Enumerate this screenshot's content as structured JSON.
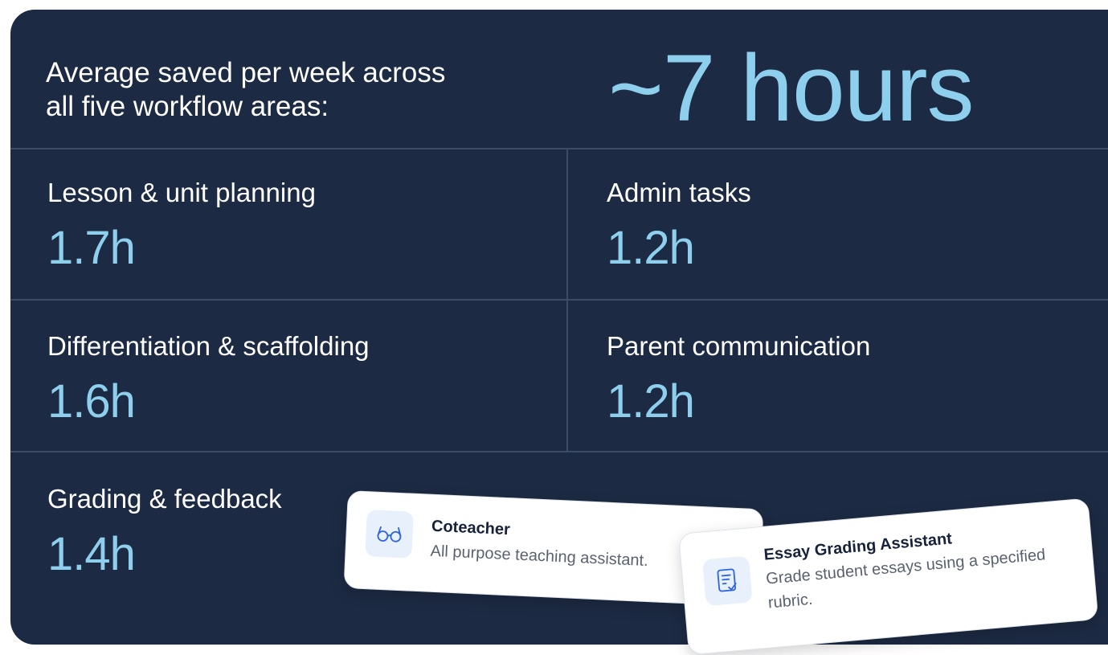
{
  "summary": {
    "label_line1": "Average saved per week across",
    "label_line2": "all five workflow areas:",
    "value": "~7 hours"
  },
  "areas": [
    {
      "label": "Lesson & unit planning",
      "value": "1.7h"
    },
    {
      "label": "Admin tasks",
      "value": "1.2h"
    },
    {
      "label": "Differentiation & scaffolding",
      "value": "1.6h"
    },
    {
      "label": "Parent communication",
      "value": "1.2h"
    },
    {
      "label": "Grading & feedback",
      "value": "1.4h"
    }
  ],
  "cards": [
    {
      "title": "Coteacher",
      "subtitle": "All purpose teaching assistant.",
      "icon": "glasses-icon"
    },
    {
      "title": "Essay Grading Assistant",
      "subtitle": "Grade student essays using a specified rubric.",
      "icon": "document-check-icon"
    }
  ],
  "colors": {
    "panel_bg": "#1c2a43",
    "accent": "#8dcfec",
    "divider": "#3d4c66",
    "icon_blue": "#2f64e0"
  }
}
